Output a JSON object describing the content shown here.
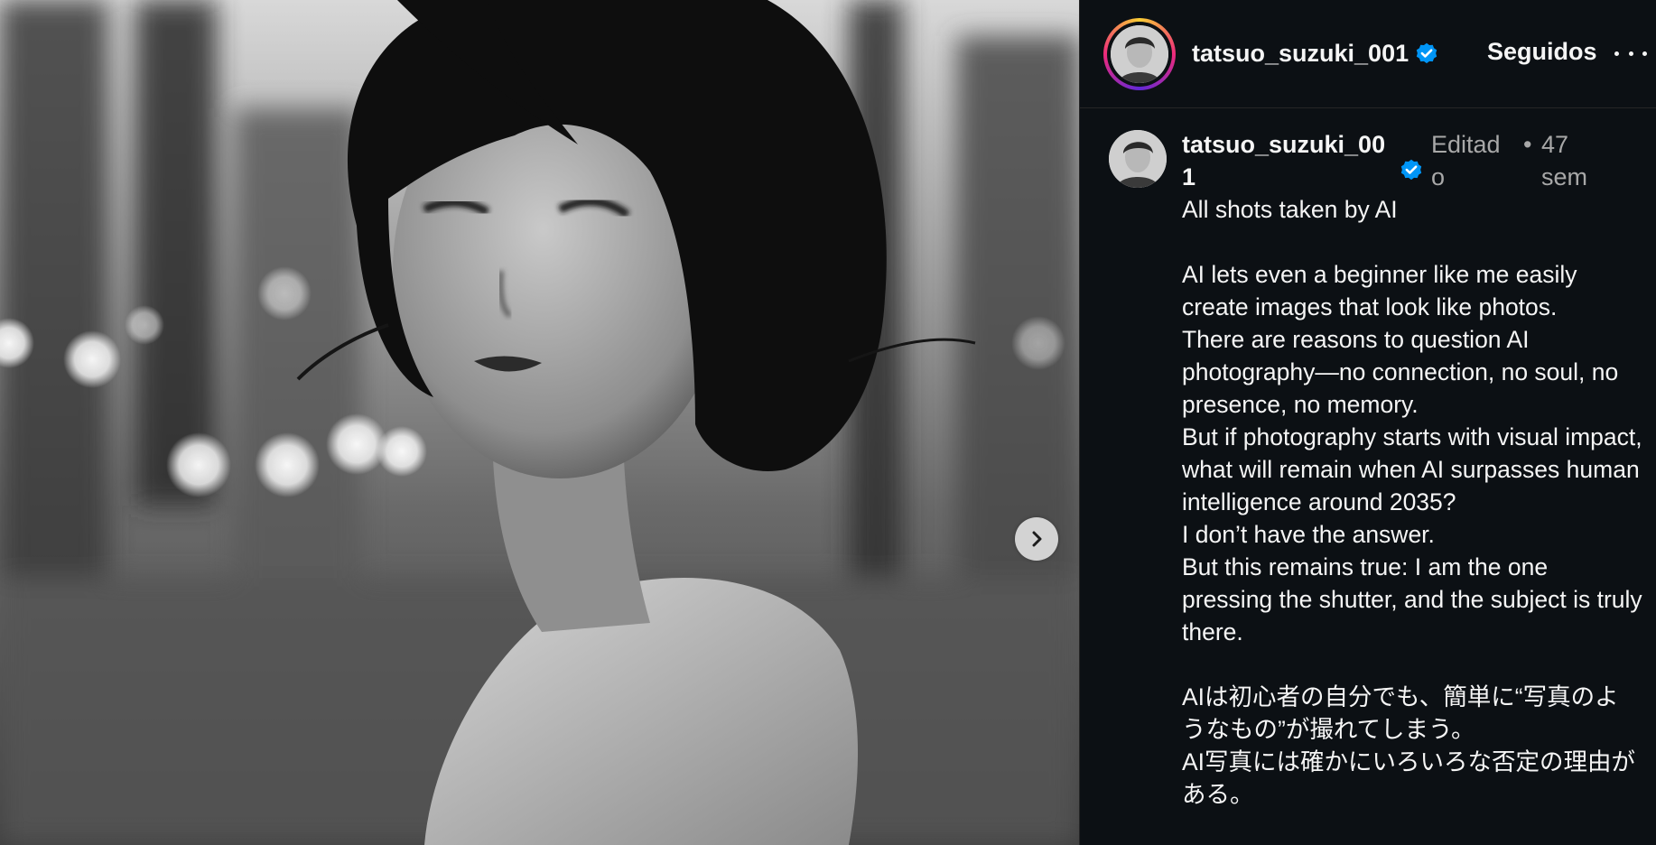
{
  "post": {
    "username": "tatsuo_suzuki_001",
    "follow_state": "Seguidos",
    "caption": {
      "username": "tatsuo_suzuki_001",
      "edited_label": "Editado",
      "separator": "•",
      "time_ago": "47 sem",
      "text": "All shots taken by AI\n\nAI lets even a beginner like me easily create images that look like photos.\nThere are reasons to question AI photography—no connection, no soul, no presence, no memory.\nBut if photography starts with visual impact, what will remain when AI surpasses human intelligence around 2035?\nI don’t have the answer.\nBut this remains true: I am the one pressing the shutter, and the subject is truly there.\n\nAIは初心者の自分でも、簡単に“写真のようなもの”が撮れてしまう。\nAI写真には確かにいろいろな否定の理由がある。"
    }
  },
  "icons": {
    "verified": "verified-badge-icon",
    "more": "more-options-icon",
    "next": "chevron-right-icon"
  },
  "colors": {
    "background": "#0c1014",
    "verified_blue": "#0095f6",
    "text_primary": "#f5f5f5",
    "text_secondary": "#a8a8a8"
  }
}
